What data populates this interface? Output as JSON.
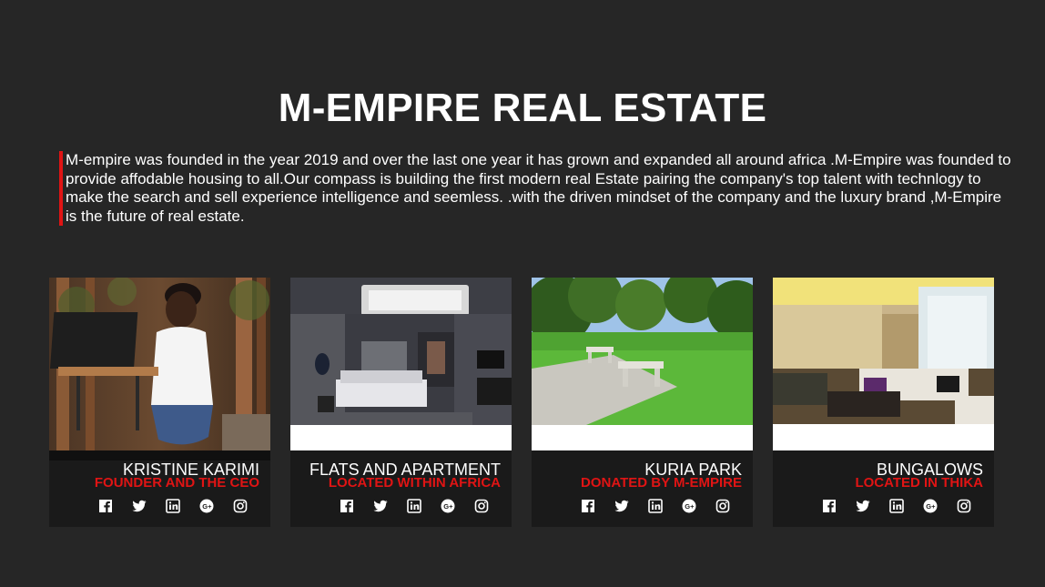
{
  "page": {
    "title": "M-EMPIRE REAL ESTATE",
    "intro": "M-empire was founded in the year 2019 and over the last one year it has grown and expanded all around africa .M-Empire was founded to provide affodable housing to all.Our compass is building the first modern real Estate pairing the company's top talent with technlogy to make the search and sell experience intelligence and seemless. .with the driven mindset of the company and the luxury brand ,M-Empire is the future of real estate."
  },
  "cards": [
    {
      "name": "KRISTINE KARIMI",
      "subtitle": "FOUNDER AND THE CEO",
      "photo": "woman-with-laptop-in-forest"
    },
    {
      "name": "FLATS AND APARTMENT",
      "subtitle": "LOCATED WITHIN AFRICA",
      "photo": "modern-bedroom-interior"
    },
    {
      "name": "KURIA PARK",
      "subtitle": "DONATED BY M-EMPIRE",
      "photo": "park-with-picnic-tables"
    },
    {
      "name": "BUNGALOWS",
      "subtitle": "LOCATED IN THIKA",
      "photo": "luxury-living-room"
    }
  ],
  "social_icons": [
    "facebook-icon",
    "twitter-icon",
    "linkedin-icon",
    "google-plus-icon",
    "instagram-icon"
  ],
  "colors": {
    "background": "#262626",
    "card": "#1a1a1a",
    "accent": "#e01414",
    "text": "#ffffff"
  }
}
